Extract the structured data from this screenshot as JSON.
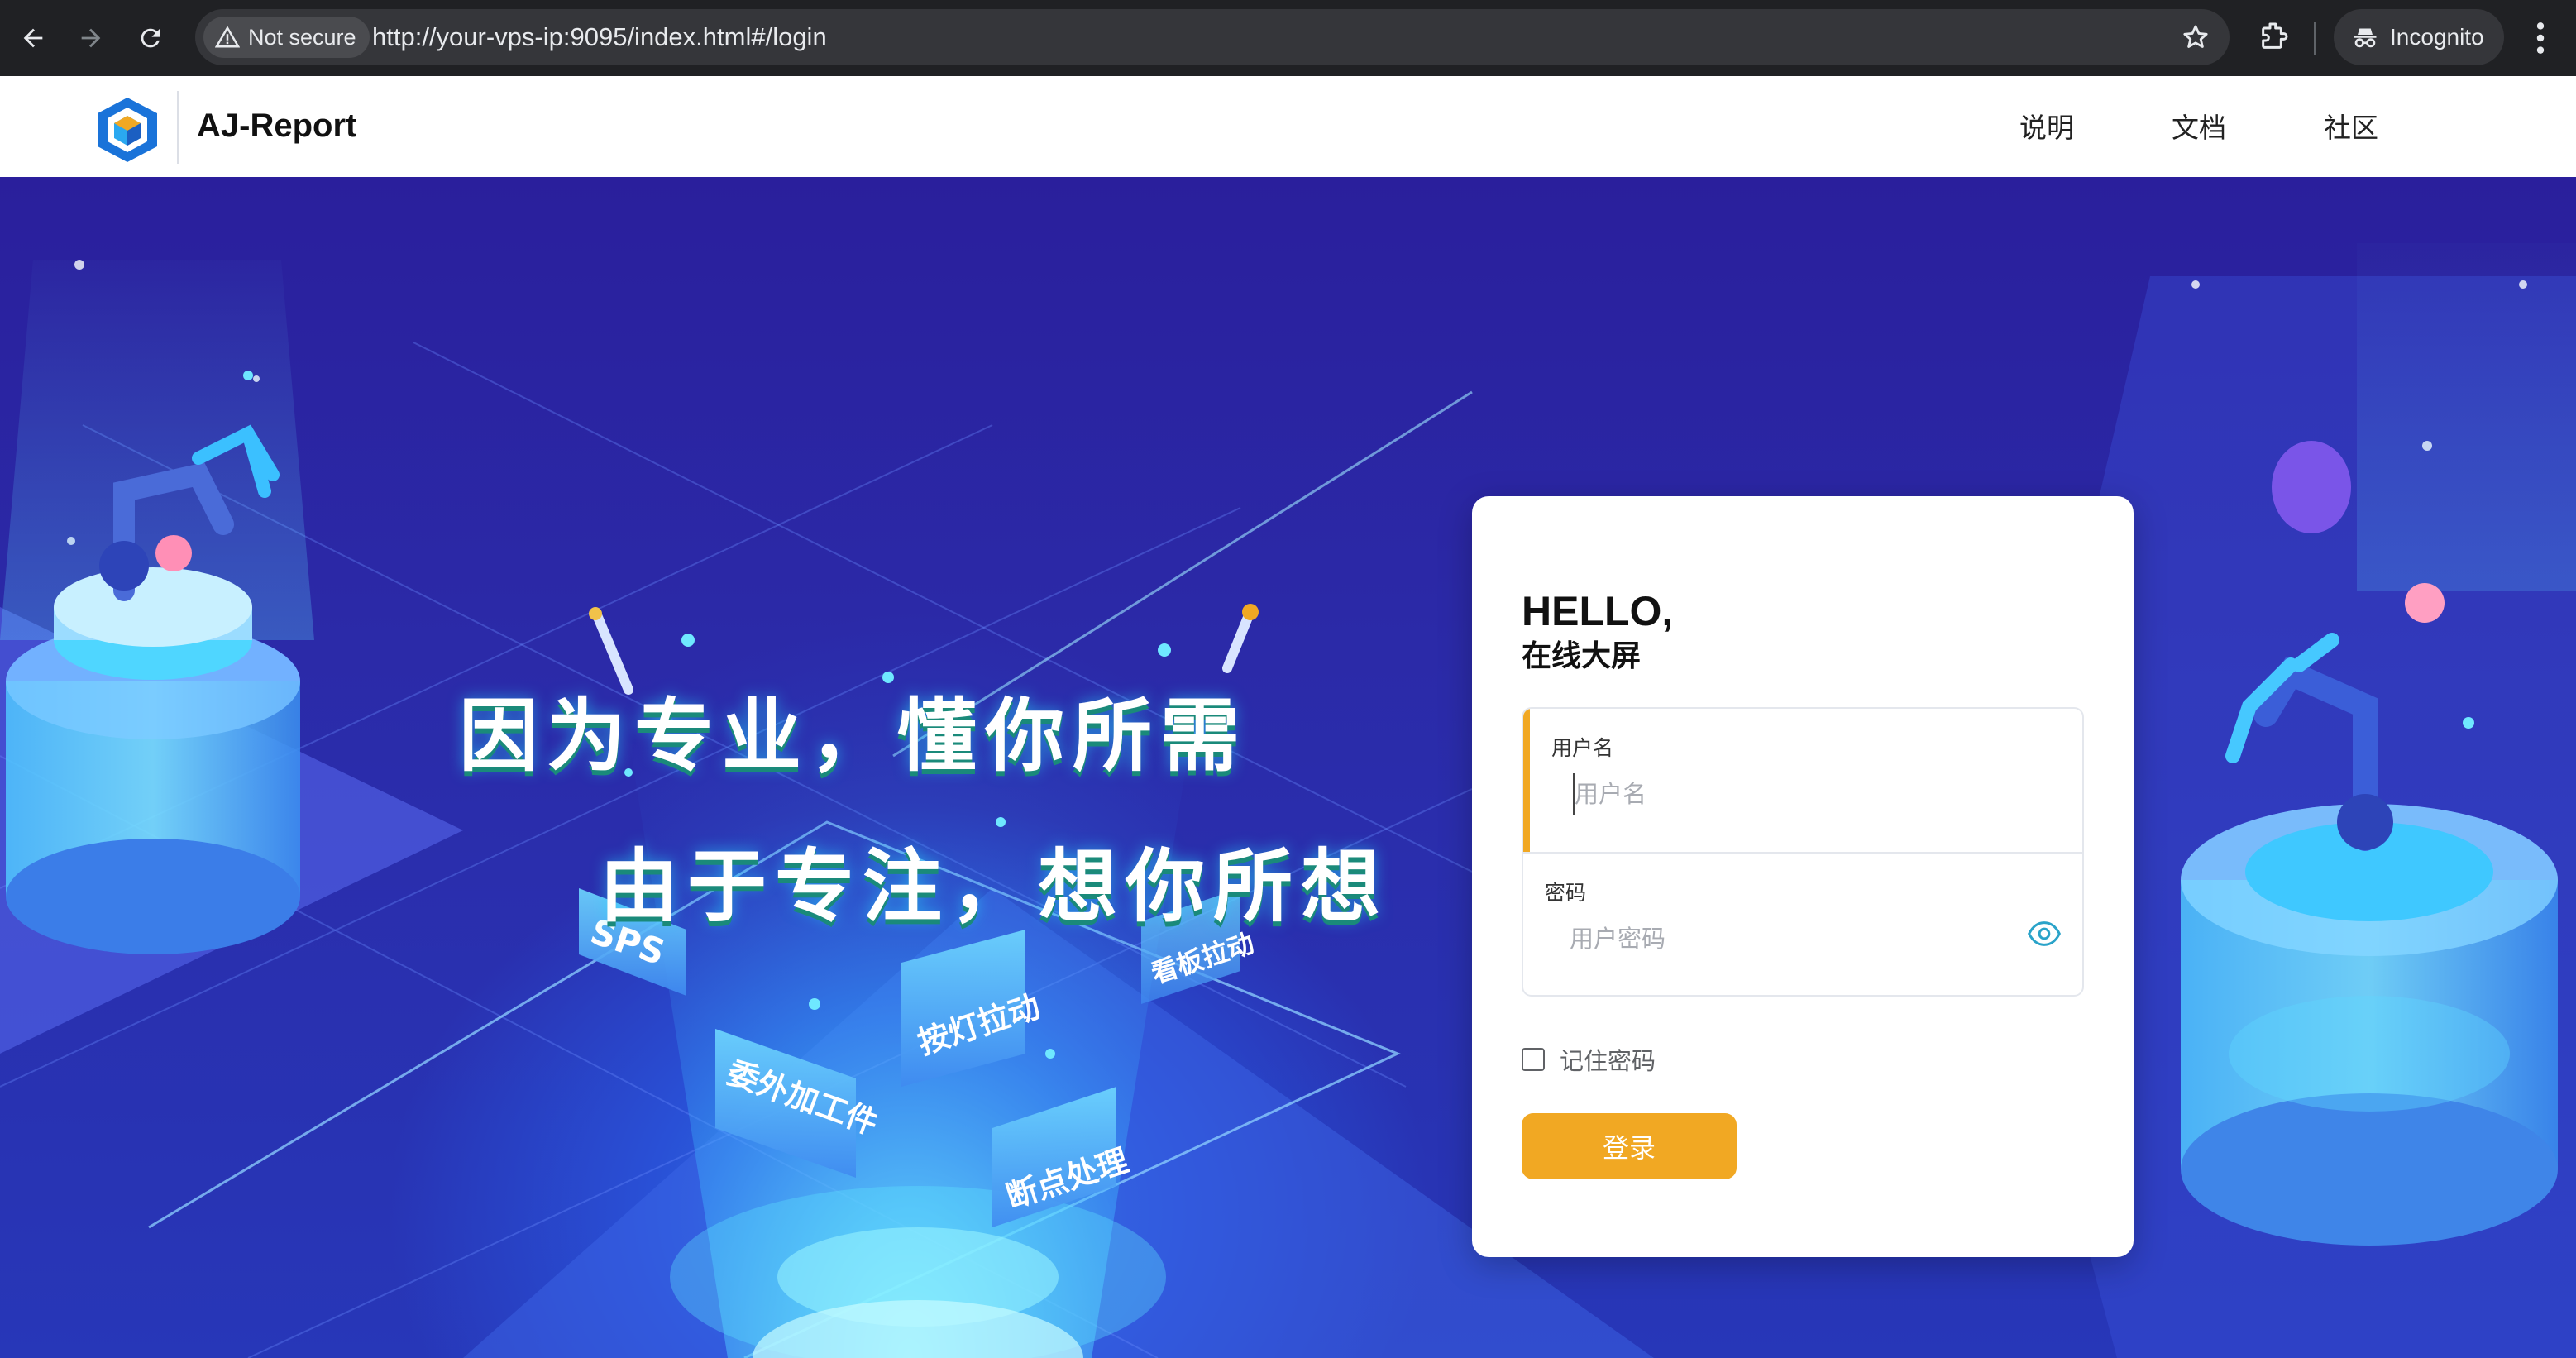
{
  "browser": {
    "security_label": "Not secure",
    "url": "http://your-vps-ip:9095/index.html#/login",
    "incognito_label": "Incognito"
  },
  "header": {
    "app_title": "AJ-Report",
    "nav": [
      "说明",
      "文档",
      "社区"
    ]
  },
  "hero": {
    "slogan_line1": "因为专业，懂你所需",
    "slogan_line2": "由于专注，想你所想",
    "tiles": [
      "SPS",
      "按灯拉动",
      "看板拉动",
      "委外加工件",
      "断点处理"
    ]
  },
  "login": {
    "hello": "HELLO,",
    "subtitle": "在线大屏",
    "username_label": "用户名",
    "username_placeholder": "用户名",
    "password_label": "密码",
    "password_placeholder": "用户密码",
    "remember_label": "记住密码",
    "submit_label": "登录"
  },
  "colors": {
    "accent": "#f1a823",
    "hero_bg": "#2a1f9c",
    "chrome_bg": "#202124"
  }
}
